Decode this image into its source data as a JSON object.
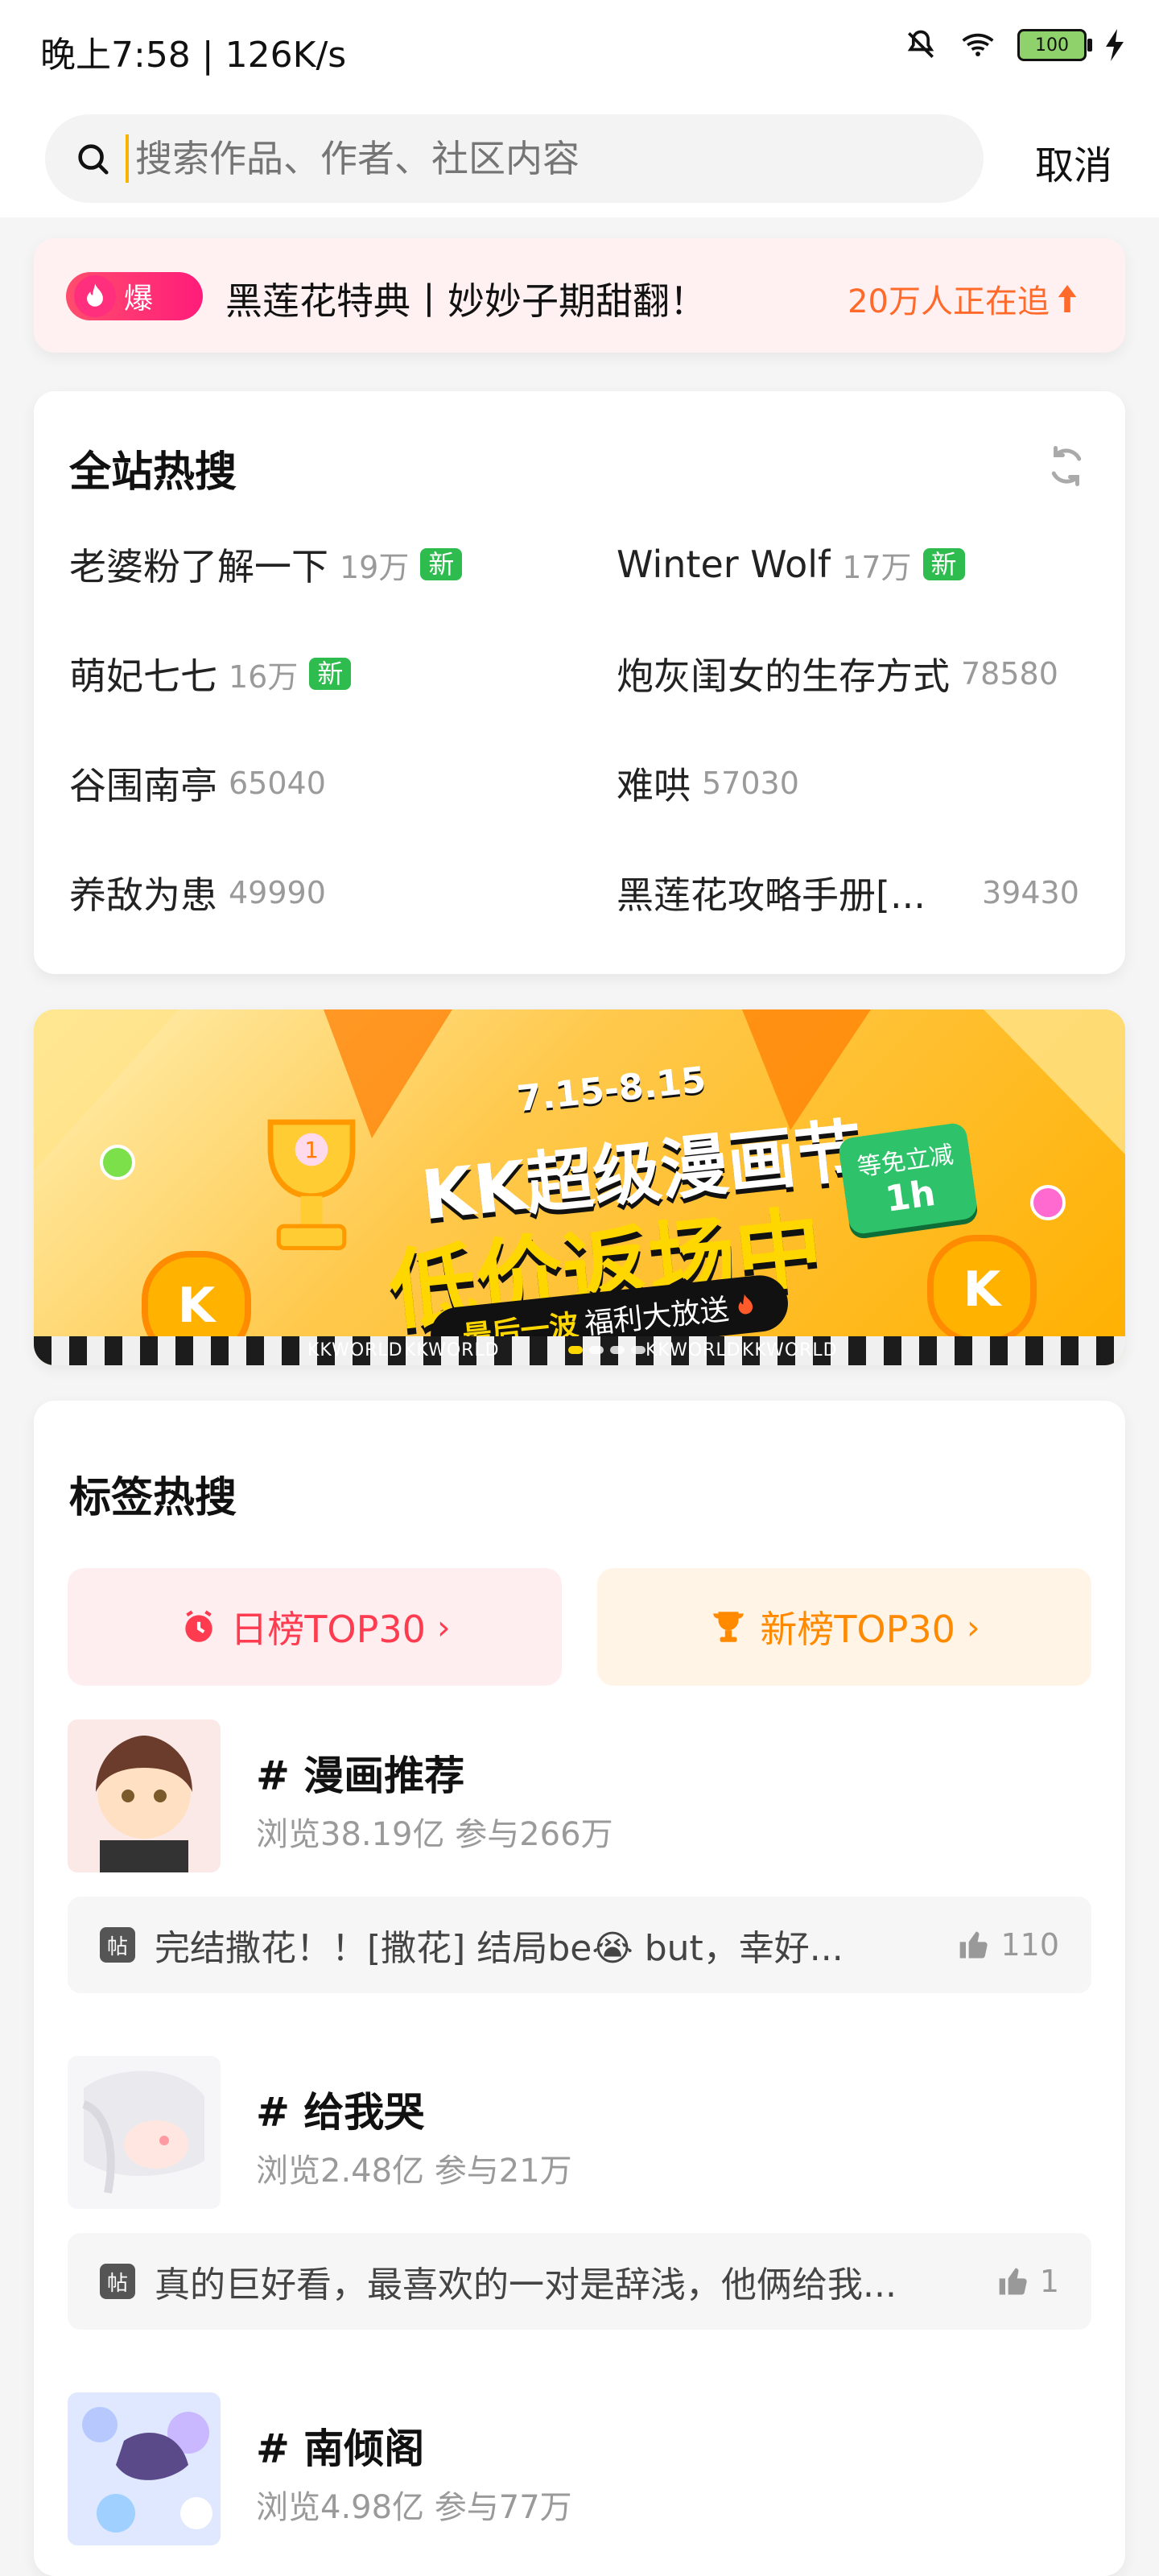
{
  "status": {
    "time": "晚上7:58 | 126K/s",
    "battery": "100"
  },
  "search": {
    "placeholder": "搜索作品、作者、社区内容",
    "cancel": "取消"
  },
  "promo": {
    "badge": "爆",
    "title": "黑莲花特典丨妙妙子期甜翻！",
    "chase": "20万人正在追"
  },
  "hot": {
    "title": "全站热搜",
    "items": [
      {
        "name": "老婆粉了解一下",
        "count": "19万",
        "tag": "新"
      },
      {
        "name": "Winter Wolf",
        "count": "17万",
        "tag": "新"
      },
      {
        "name": "萌妃七七",
        "count": "16万",
        "tag": "新"
      },
      {
        "name": "炮灰闺女的生存方式",
        "count": "78580",
        "tag": ""
      },
      {
        "name": "谷围南亭",
        "count": "65040",
        "tag": ""
      },
      {
        "name": "难哄",
        "count": "57030",
        "tag": ""
      },
      {
        "name": "养敌为患",
        "count": "49990",
        "tag": ""
      },
      {
        "name": "黑莲花攻略手册[...",
        "count": "39430",
        "tag": ""
      }
    ]
  },
  "banner": {
    "date": "7.15-8.15",
    "line1": "KK超级漫画节",
    "line2": "低价返场中",
    "pill_highlight": "最后一波",
    "pill_rest": "福利大放送",
    "tag_top": "等免立减",
    "tag_bottom": "1h",
    "coin": "K",
    "kk1": "KKWORLD",
    "kk2": "KKWORLD",
    "kk3": "KKWORLD",
    "kk4": "KKWORLD"
  },
  "tags": {
    "title": "标签热搜",
    "daily_label": "日榜TOP30",
    "new_label": "新榜TOP30",
    "items": [
      {
        "name": "# 漫画推荐",
        "stats": "浏览38.19亿 参与266万",
        "post": "完结撒花！！[撒花] 结局be😭  but，幸好...",
        "likes": "110",
        "post_icon": "帖"
      },
      {
        "name": "# 给我哭",
        "stats": "浏览2.48亿 参与21万",
        "post": "真的巨好看，最喜欢的一对是辞浅，他俩给我...",
        "likes": "1",
        "post_icon": "帖"
      },
      {
        "name": "# 南倾阁",
        "stats": "浏览4.98亿 参与77万",
        "post": "",
        "likes": "",
        "post_icon": ""
      }
    ]
  },
  "colors": {
    "accent_orange": "#ff6a2a",
    "accent_red": "#ff3b50",
    "new_green": "#2fbc4f"
  }
}
